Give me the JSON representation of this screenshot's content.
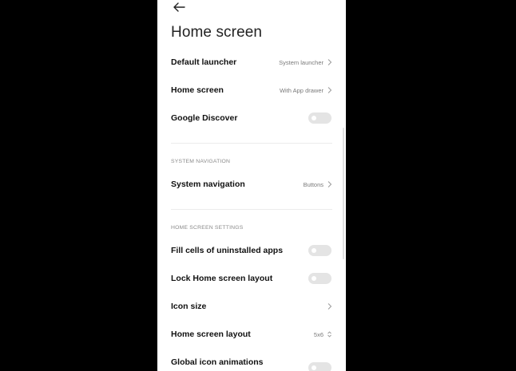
{
  "header": {
    "title": "Home screen"
  },
  "rows": {
    "default_launcher": {
      "label": "Default launcher",
      "value": "System launcher"
    },
    "home_screen": {
      "label": "Home screen",
      "value": "With App drawer"
    },
    "google_discover": {
      "label": "Google Discover",
      "toggle": false
    },
    "system_navigation": {
      "label": "System navigation",
      "value": "Buttons"
    },
    "fill_cells": {
      "label": "Fill cells of uninstalled apps",
      "toggle": false
    },
    "lock_layout": {
      "label": "Lock Home screen layout",
      "toggle": false
    },
    "icon_size": {
      "label": "Icon size"
    },
    "home_layout": {
      "label": "Home screen layout",
      "value": "5x6"
    },
    "global_anim": {
      "label": "Global icon animations",
      "toggle": false
    }
  },
  "sections": {
    "system_navigation": "SYSTEM NAVIGATION",
    "home_screen_settings": "HOME SCREEN SETTINGS"
  },
  "colors": {
    "background": "#000000",
    "surface": "#ffffff",
    "toggle_off": "#e4e4e4",
    "secondary_text": "#7a7a7a"
  },
  "icons": {
    "back": "arrow-left-icon",
    "chevron": "chevron-right-icon",
    "stepper": "chevron-up-down-icon"
  }
}
